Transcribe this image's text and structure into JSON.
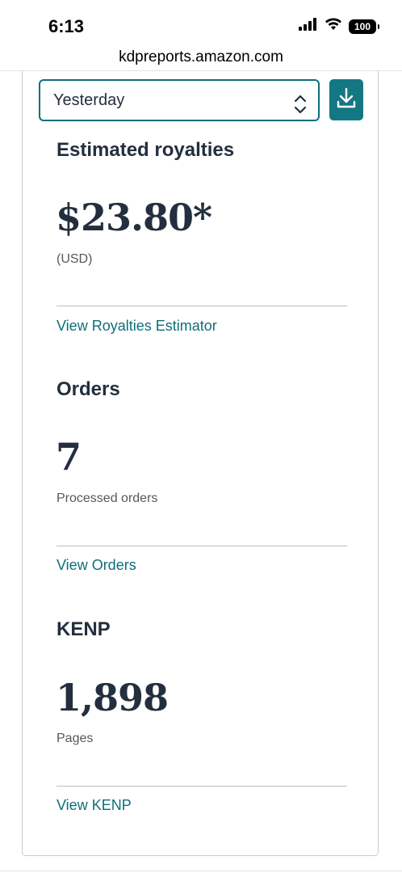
{
  "status_bar": {
    "time": "6:13",
    "battery": "100"
  },
  "browser": {
    "url": "kdpreports.amazon.com"
  },
  "filter": {
    "selected": "Yesterday"
  },
  "royalties": {
    "title": "Estimated royalties",
    "value": "$23.80*",
    "currency": "(USD)",
    "link": "View Royalties Estimator"
  },
  "orders": {
    "title": "Orders",
    "value": "7",
    "label": "Processed orders",
    "link": "View Orders"
  },
  "kenp": {
    "title": "KENP",
    "value": "1,898",
    "label": "Pages",
    "link": "View KENP"
  },
  "colors": {
    "accent": "#147884",
    "text": "#232f3e",
    "muted": "#565959"
  }
}
